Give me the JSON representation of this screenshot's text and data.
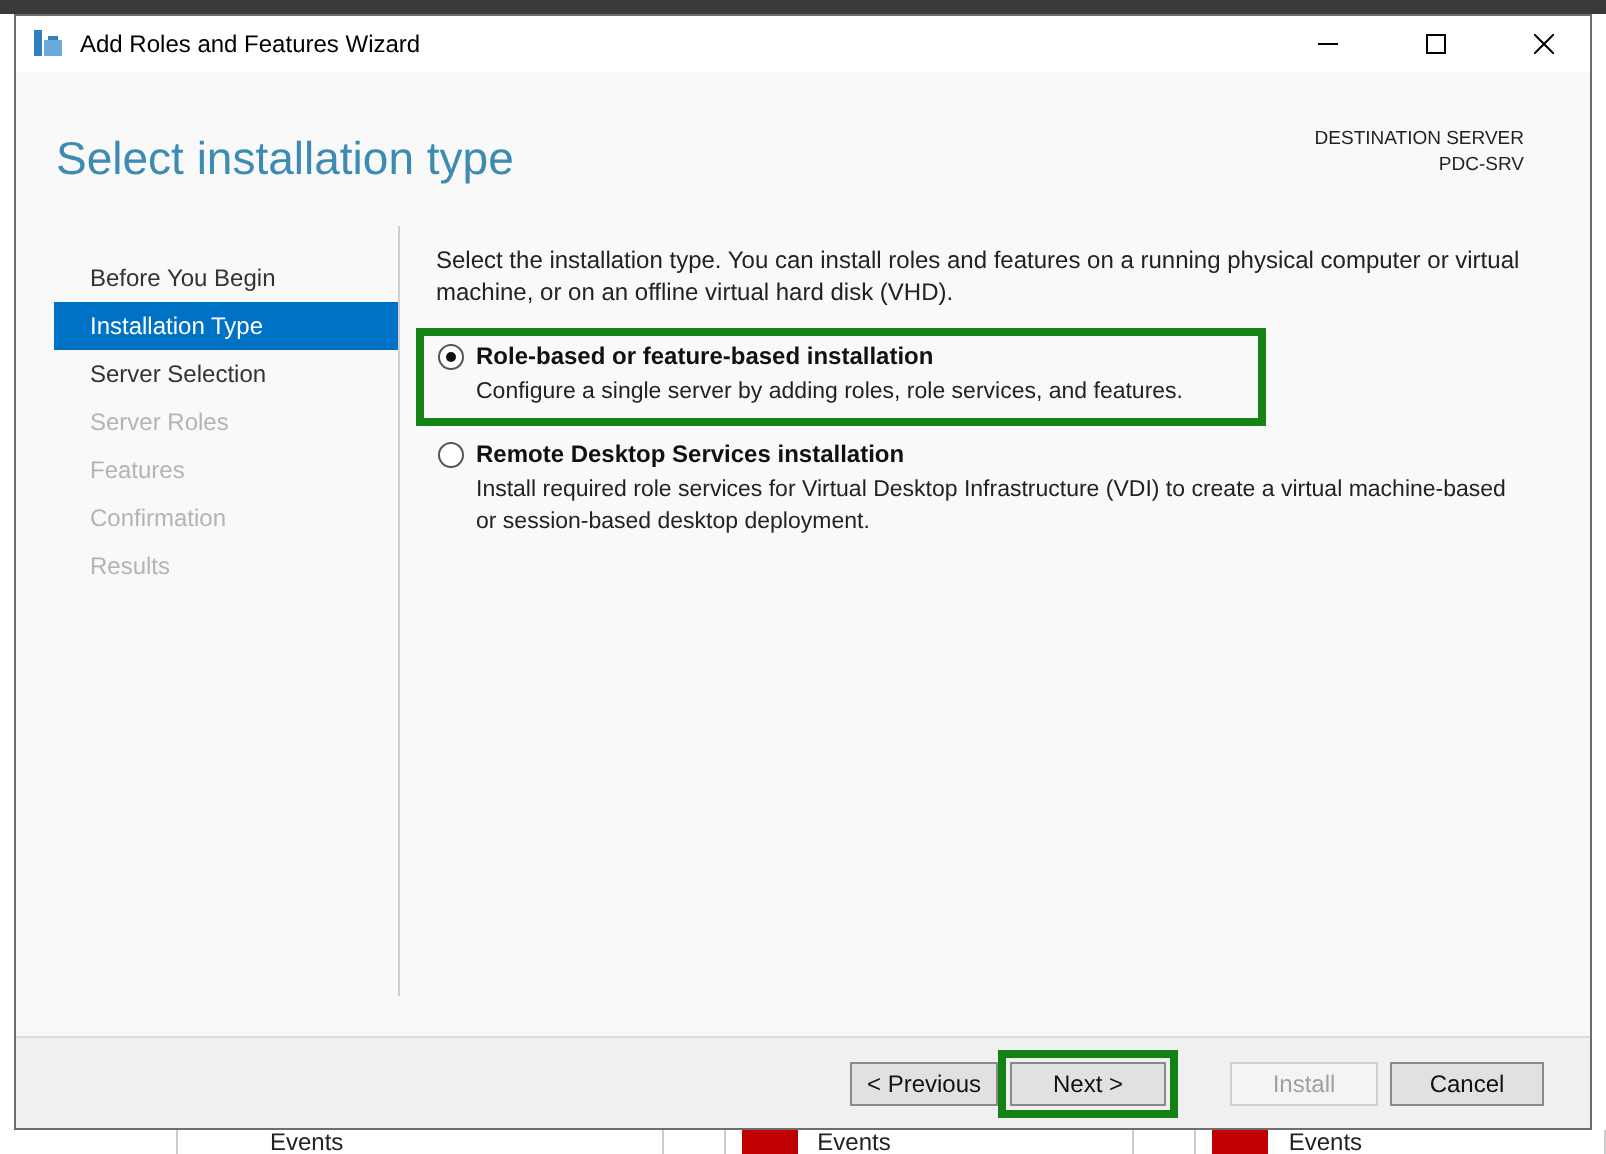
{
  "window": {
    "title": "Add Roles and Features Wizard"
  },
  "header": {
    "title": "Select installation type",
    "destination_label": "DESTINATION SERVER",
    "destination_server": "PDC-SRV"
  },
  "steps": [
    {
      "label": "Before You Begin",
      "selected": false,
      "disabled": false
    },
    {
      "label": "Installation Type",
      "selected": true,
      "disabled": false
    },
    {
      "label": "Server Selection",
      "selected": false,
      "disabled": false
    },
    {
      "label": "Server Roles",
      "selected": false,
      "disabled": true
    },
    {
      "label": "Features",
      "selected": false,
      "disabled": true
    },
    {
      "label": "Confirmation",
      "selected": false,
      "disabled": true
    },
    {
      "label": "Results",
      "selected": false,
      "disabled": true
    }
  ],
  "intro": "Select the installation type. You can install roles and features on a running physical computer or virtual machine, or on an offline virtual hard disk (VHD).",
  "options": [
    {
      "title": "Role-based or feature-based installation",
      "description": "Configure a single server by adding roles, role services, and features.",
      "selected": true,
      "highlighted": true
    },
    {
      "title": "Remote Desktop Services installation",
      "description": "Install required role services for Virtual Desktop Infrastructure (VDI) to create a virtual machine-based or session-based desktop deployment.",
      "selected": false,
      "highlighted": false
    }
  ],
  "buttons": [
    {
      "label": "< Previous",
      "disabled": false,
      "highlighted": false
    },
    {
      "label": "Next >",
      "disabled": false,
      "highlighted": true
    },
    {
      "label": "Install",
      "disabled": true,
      "highlighted": false
    },
    {
      "label": "Cancel",
      "disabled": false,
      "highlighted": false
    }
  ],
  "background_tiles": [
    {
      "label": "Events",
      "alert": false
    },
    {
      "label": "Events",
      "alert": true
    },
    {
      "label": "Events",
      "alert": true
    }
  ]
}
